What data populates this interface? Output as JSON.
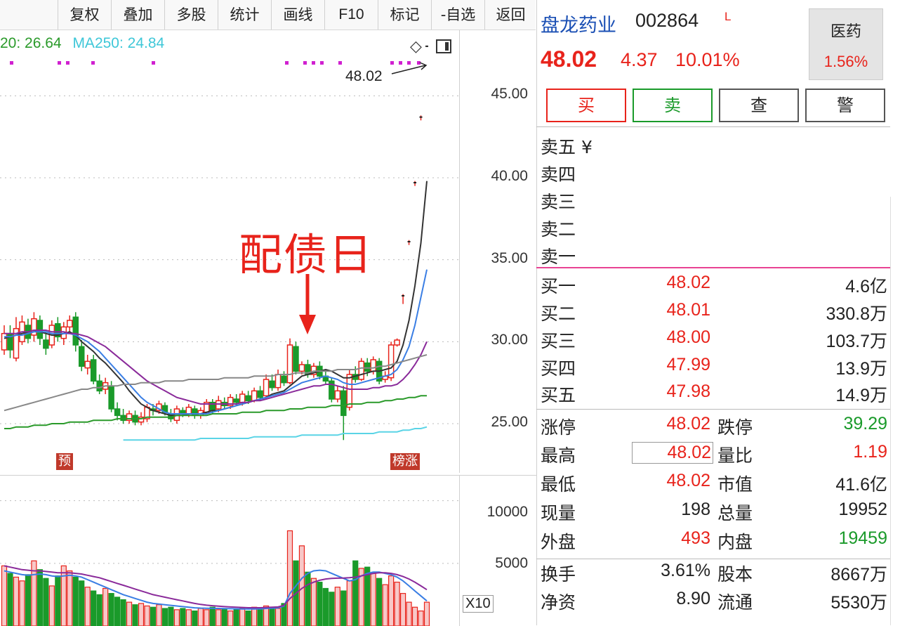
{
  "toolbar": {
    "items": [
      "复权",
      "叠加",
      "多股",
      "统计",
      "画线",
      "F10",
      "标记",
      "-自选",
      "返回"
    ]
  },
  "ma_legend": {
    "ma20": "20: 26.64",
    "ma250": "MA250: 24.84"
  },
  "chart": {
    "latest_price_label": "48.02",
    "annotation": "配债日",
    "badge_left": "预",
    "badge_right": "榜涨",
    "price_ticks": [
      "45.00",
      "40.00",
      "35.00",
      "30.00",
      "25.00"
    ],
    "volume_ticks": [
      "10000",
      "5000"
    ],
    "volume_scale": "X10",
    "colors": {
      "up": "#e8231b",
      "down": "#1a9a2a"
    }
  },
  "chart_data": {
    "type": "line",
    "title": "",
    "ylim": [
      22,
      49
    ],
    "candles": [
      {
        "o": 29.5,
        "c": 30.5,
        "h": 31.0,
        "l": 29.2
      },
      {
        "o": 30.5,
        "c": 29.5,
        "h": 31.0,
        "l": 29.0
      },
      {
        "o": 29.0,
        "c": 30.8,
        "h": 31.5,
        "l": 28.8
      },
      {
        "o": 30.0,
        "c": 31.2,
        "h": 31.6,
        "l": 29.8
      },
      {
        "o": 31.0,
        "c": 30.2,
        "h": 31.4,
        "l": 29.9
      },
      {
        "o": 30.4,
        "c": 31.4,
        "h": 31.8,
        "l": 30.0
      },
      {
        "o": 31.3,
        "c": 30.2,
        "h": 31.6,
        "l": 29.8
      },
      {
        "o": 30.1,
        "c": 29.6,
        "h": 30.6,
        "l": 29.2
      },
      {
        "o": 29.8,
        "c": 31.0,
        "h": 31.3,
        "l": 29.6
      },
      {
        "o": 31.1,
        "c": 30.3,
        "h": 31.5,
        "l": 30.0
      },
      {
        "o": 30.2,
        "c": 30.9,
        "h": 31.2,
        "l": 29.8
      },
      {
        "o": 30.9,
        "c": 31.3,
        "h": 31.6,
        "l": 30.6
      },
      {
        "o": 31.5,
        "c": 29.8,
        "h": 31.8,
        "l": 29.4
      },
      {
        "o": 29.7,
        "c": 28.5,
        "h": 30.1,
        "l": 28.2
      },
      {
        "o": 28.4,
        "c": 28.8,
        "h": 29.2,
        "l": 28.0
      },
      {
        "o": 28.9,
        "c": 27.6,
        "h": 29.2,
        "l": 27.4
      },
      {
        "o": 27.6,
        "c": 27.0,
        "h": 28.0,
        "l": 26.8
      },
      {
        "o": 27.1,
        "c": 27.5,
        "h": 27.8,
        "l": 26.8
      },
      {
        "o": 27.3,
        "c": 25.9,
        "h": 27.6,
        "l": 25.7
      },
      {
        "o": 25.9,
        "c": 25.5,
        "h": 26.3,
        "l": 25.2
      },
      {
        "o": 25.5,
        "c": 25.2,
        "h": 25.9,
        "l": 25.0
      },
      {
        "o": 25.2,
        "c": 25.6,
        "h": 25.8,
        "l": 25.0
      },
      {
        "o": 25.5,
        "c": 25.1,
        "h": 25.8,
        "l": 24.9
      },
      {
        "o": 25.1,
        "c": 25.4,
        "h": 25.7,
        "l": 24.9
      },
      {
        "o": 25.3,
        "c": 26.0,
        "h": 26.2,
        "l": 25.1
      },
      {
        "o": 25.9,
        "c": 25.8,
        "h": 26.2,
        "l": 25.5
      },
      {
        "o": 25.8,
        "c": 26.2,
        "h": 26.4,
        "l": 25.6
      },
      {
        "o": 26.1,
        "c": 25.7,
        "h": 26.3,
        "l": 25.5
      },
      {
        "o": 25.6,
        "c": 25.3,
        "h": 25.9,
        "l": 25.1
      },
      {
        "o": 25.2,
        "c": 25.9,
        "h": 26.1,
        "l": 25.0
      },
      {
        "o": 25.8,
        "c": 25.6,
        "h": 26.0,
        "l": 25.4
      },
      {
        "o": 25.6,
        "c": 26.0,
        "h": 26.2,
        "l": 25.4
      },
      {
        "o": 25.9,
        "c": 25.5,
        "h": 26.1,
        "l": 25.3
      },
      {
        "o": 25.5,
        "c": 25.8,
        "h": 26.0,
        "l": 25.3
      },
      {
        "o": 25.7,
        "c": 26.3,
        "h": 26.5,
        "l": 25.6
      },
      {
        "o": 26.3,
        "c": 25.8,
        "h": 26.5,
        "l": 25.6
      },
      {
        "o": 25.9,
        "c": 26.4,
        "h": 26.7,
        "l": 25.7
      },
      {
        "o": 26.3,
        "c": 26.1,
        "h": 26.6,
        "l": 25.9
      },
      {
        "o": 26.1,
        "c": 26.6,
        "h": 26.8,
        "l": 25.9
      },
      {
        "o": 26.5,
        "c": 26.3,
        "h": 26.8,
        "l": 26.1
      },
      {
        "o": 26.3,
        "c": 26.8,
        "h": 27.0,
        "l": 26.1
      },
      {
        "o": 26.7,
        "c": 26.4,
        "h": 27.0,
        "l": 26.2
      },
      {
        "o": 26.4,
        "c": 27.0,
        "h": 27.2,
        "l": 26.3
      },
      {
        "o": 27.0,
        "c": 26.6,
        "h": 27.3,
        "l": 26.4
      },
      {
        "o": 26.7,
        "c": 27.7,
        "h": 28.0,
        "l": 26.6
      },
      {
        "o": 27.6,
        "c": 27.2,
        "h": 28.0,
        "l": 27.0
      },
      {
        "o": 27.2,
        "c": 28.0,
        "h": 28.3,
        "l": 27.0
      },
      {
        "o": 27.9,
        "c": 27.5,
        "h": 28.2,
        "l": 27.3
      },
      {
        "o": 27.5,
        "c": 29.8,
        "h": 30.2,
        "l": 27.4
      },
      {
        "o": 29.7,
        "c": 28.2,
        "h": 30.0,
        "l": 28.0
      },
      {
        "o": 28.2,
        "c": 28.6,
        "h": 28.8,
        "l": 28.0
      },
      {
        "o": 28.6,
        "c": 28.0,
        "h": 28.9,
        "l": 27.8
      },
      {
        "o": 28.0,
        "c": 28.5,
        "h": 28.7,
        "l": 27.8
      },
      {
        "o": 28.5,
        "c": 27.9,
        "h": 28.8,
        "l": 27.7
      },
      {
        "o": 27.9,
        "c": 27.6,
        "h": 28.3,
        "l": 27.4
      },
      {
        "o": 27.6,
        "c": 26.5,
        "h": 27.8,
        "l": 26.3
      },
      {
        "o": 26.5,
        "c": 27.0,
        "h": 27.3,
        "l": 26.3
      },
      {
        "o": 27.0,
        "c": 25.5,
        "h": 27.3,
        "l": 24.0
      },
      {
        "o": 26.0,
        "c": 28.0,
        "h": 28.3,
        "l": 25.8
      },
      {
        "o": 28.0,
        "c": 27.7,
        "h": 28.5,
        "l": 27.5
      },
      {
        "o": 27.7,
        "c": 28.8,
        "h": 29.0,
        "l": 27.6
      },
      {
        "o": 28.7,
        "c": 28.2,
        "h": 29.0,
        "l": 27.9
      },
      {
        "o": 28.2,
        "c": 28.9,
        "h": 29.1,
        "l": 28.0
      },
      {
        "o": 28.8,
        "c": 27.6,
        "h": 29.0,
        "l": 27.4
      },
      {
        "o": 27.7,
        "c": 27.9,
        "h": 28.2,
        "l": 27.5
      },
      {
        "o": 27.8,
        "c": 29.8,
        "h": 30.0,
        "l": 27.6
      },
      {
        "o": 29.8,
        "c": 30.1,
        "h": 30.2,
        "l": 29.7
      },
      {
        "o": 32.4,
        "c": 32.8,
        "h": 32.9,
        "l": 32.3
      },
      {
        "o": 36.0,
        "c": 36.1,
        "h": 36.2,
        "l": 35.9
      },
      {
        "o": 39.6,
        "c": 39.7,
        "h": 39.8,
        "l": 39.5
      },
      {
        "o": 43.6,
        "c": 43.7,
        "h": 43.8,
        "l": 43.5
      },
      {
        "o": 48.0,
        "c": 48.02,
        "h": 48.02,
        "l": 48.0
      }
    ],
    "ma_lines": [
      {
        "color": "#333333",
        "values": [
          30.2,
          30.3,
          30.4,
          30.5,
          30.6,
          30.7,
          30.6,
          30.5,
          30.4,
          30.4,
          30.5,
          30.6,
          30.4,
          30.0,
          29.7,
          29.4,
          29.0,
          28.7,
          28.3,
          27.9,
          27.5,
          27.0,
          26.6,
          26.2,
          26.0,
          25.8,
          25.7,
          25.6,
          25.5,
          25.5,
          25.5,
          25.6,
          25.6,
          25.6,
          25.7,
          25.8,
          25.8,
          25.9,
          26.0,
          26.1,
          26.2,
          26.3,
          26.4,
          26.5,
          26.6,
          26.8,
          26.9,
          27.0,
          27.3,
          27.6,
          27.9,
          28.0,
          28.1,
          28.2,
          28.3,
          28.2,
          28.0,
          27.8,
          27.8,
          27.9,
          28.0,
          28.1,
          28.2,
          28.2,
          28.3,
          28.4,
          28.8,
          29.8,
          31.3,
          33.4,
          36.0,
          39.8
        ]
      },
      {
        "color": "#3a7ee4",
        "values": [
          30.3,
          30.3,
          30.4,
          30.4,
          30.5,
          30.6,
          30.6,
          30.6,
          30.5,
          30.5,
          30.5,
          30.5,
          30.4,
          30.2,
          30.0,
          29.7,
          29.4,
          29.0,
          28.6,
          28.2,
          27.8,
          27.4,
          27.0,
          26.6,
          26.3,
          26.1,
          25.9,
          25.7,
          25.6,
          25.6,
          25.6,
          25.6,
          25.6,
          25.6,
          25.6,
          25.7,
          25.8,
          25.9,
          26.0,
          26.1,
          26.2,
          26.3,
          26.4,
          26.5,
          26.6,
          26.7,
          26.8,
          26.9,
          27.1,
          27.3,
          27.5,
          27.6,
          27.7,
          27.8,
          27.9,
          27.8,
          27.7,
          27.5,
          27.4,
          27.4,
          27.5,
          27.6,
          27.7,
          27.8,
          27.9,
          28.0,
          28.3,
          28.9,
          29.7,
          31.0,
          32.7,
          34.4
        ]
      },
      {
        "color": "#8a2a9a",
        "values": [
          30.5,
          30.5,
          30.5,
          30.6,
          30.6,
          30.7,
          30.7,
          30.7,
          30.6,
          30.6,
          30.6,
          30.5,
          30.5,
          30.4,
          30.3,
          30.1,
          29.9,
          29.7,
          29.4,
          29.1,
          28.8,
          28.5,
          28.2,
          27.9,
          27.6,
          27.4,
          27.2,
          27.0,
          26.8,
          26.6,
          26.5,
          26.4,
          26.3,
          26.2,
          26.2,
          26.2,
          26.2,
          26.2,
          26.2,
          26.2,
          26.3,
          26.3,
          26.4,
          26.4,
          26.5,
          26.6,
          26.7,
          26.8,
          26.9,
          27.0,
          27.1,
          27.2,
          27.3,
          27.3,
          27.4,
          27.4,
          27.3,
          27.2,
          27.1,
          27.1,
          27.1,
          27.1,
          27.2,
          27.2,
          27.3,
          27.3,
          27.4,
          27.7,
          28.1,
          28.6,
          29.2,
          30.0
        ]
      },
      {
        "color": "#888888",
        "values": [
          25.8,
          25.9,
          26.0,
          26.1,
          26.2,
          26.3,
          26.4,
          26.5,
          26.6,
          26.7,
          26.8,
          26.9,
          27.0,
          27.1,
          27.1,
          27.2,
          27.2,
          27.3,
          27.3,
          27.3,
          27.4,
          27.4,
          27.4,
          27.5,
          27.5,
          27.5,
          27.5,
          27.6,
          27.6,
          27.6,
          27.6,
          27.7,
          27.7,
          27.7,
          27.7,
          27.7,
          27.7,
          27.8,
          27.8,
          27.8,
          27.8,
          27.8,
          27.9,
          27.9,
          27.9,
          27.9,
          28.0,
          28.0,
          28.0,
          28.1,
          28.1,
          28.1,
          28.2,
          28.2,
          28.2,
          28.2,
          28.3,
          28.3,
          28.3,
          28.3,
          28.4,
          28.4,
          28.4,
          28.5,
          28.5,
          28.6,
          28.7,
          28.8,
          28.9,
          29.0,
          29.1,
          29.2
        ]
      },
      {
        "color": "#2a9a2a",
        "values": [
          24.7,
          24.7,
          24.8,
          24.8,
          24.8,
          24.9,
          24.9,
          24.9,
          25.0,
          25.0,
          25.0,
          25.1,
          25.1,
          25.1,
          25.1,
          25.2,
          25.2,
          25.2,
          25.2,
          25.3,
          25.3,
          25.3,
          25.3,
          25.3,
          25.4,
          25.4,
          25.4,
          25.4,
          25.4,
          25.5,
          25.5,
          25.5,
          25.5,
          25.5,
          25.5,
          25.6,
          25.6,
          25.6,
          25.6,
          25.6,
          25.7,
          25.7,
          25.7,
          25.7,
          25.8,
          25.8,
          25.8,
          25.8,
          25.9,
          25.9,
          25.9,
          26.0,
          26.0,
          26.0,
          26.0,
          26.1,
          26.1,
          26.1,
          26.2,
          26.2,
          26.2,
          26.3,
          26.3,
          26.3,
          26.4,
          26.4,
          26.5,
          26.5,
          26.6,
          26.6,
          26.7,
          26.7
        ]
      },
      {
        "color": "#5ad4e6",
        "values": [
          null,
          null,
          null,
          null,
          null,
          null,
          null,
          null,
          null,
          null,
          null,
          null,
          null,
          null,
          null,
          null,
          null,
          null,
          null,
          null,
          24.0,
          24.0,
          24.0,
          24.0,
          24.0,
          24.0,
          24.0,
          24.0,
          24.0,
          24.0,
          24.0,
          24.0,
          24.0,
          24.1,
          24.1,
          24.1,
          24.1,
          24.1,
          24.1,
          24.1,
          24.1,
          24.1,
          24.2,
          24.2,
          24.2,
          24.2,
          24.2,
          24.2,
          24.2,
          24.2,
          24.3,
          24.3,
          24.3,
          24.3,
          24.3,
          24.3,
          24.3,
          24.4,
          24.4,
          24.4,
          24.4,
          24.4,
          24.4,
          24.5,
          24.5,
          24.5,
          24.5,
          24.6,
          24.6,
          24.7,
          24.7,
          24.8
        ]
      }
    ],
    "volumes": [
      480,
      420,
      390,
      360,
      410,
      520,
      450,
      380,
      320,
      400,
      480,
      440,
      390,
      360,
      310,
      280,
      250,
      300,
      260,
      230,
      210,
      190,
      170,
      180,
      160,
      150,
      170,
      140,
      150,
      130,
      140,
      130,
      120,
      140,
      130,
      150,
      130,
      140,
      120,
      130,
      140,
      120,
      150,
      130,
      160,
      150,
      140,
      180,
      760,
      520,
      640,
      430,
      380,
      350,
      300,
      270,
      310,
      280,
      360,
      520,
      460,
      470,
      420,
      380,
      330,
      400,
      350,
      260,
      190,
      150,
      120,
      190
    ],
    "vol_ma": [
      {
        "color": "#3a7ee4",
        "values": [
          440,
          430,
          420,
          410,
          405,
          410,
          415,
          410,
          400,
          395,
          400,
          405,
          400,
          390,
          370,
          350,
          330,
          310,
          290,
          270,
          250,
          235,
          220,
          205,
          190,
          180,
          175,
          170,
          165,
          160,
          155,
          150,
          145,
          143,
          142,
          141,
          140,
          139,
          138,
          137,
          136,
          135,
          136,
          137,
          140,
          142,
          144,
          160,
          260,
          320,
          380,
          420,
          440,
          445,
          440,
          420,
          400,
          380,
          360,
          370,
          400,
          420,
          430,
          430,
          420,
          410,
          390,
          360,
          320,
          280,
          240,
          200
        ]
      },
      {
        "color": "#8a2a9a",
        "values": [
          480,
          470,
          460,
          450,
          445,
          440,
          440,
          435,
          430,
          425,
          425,
          425,
          420,
          415,
          405,
          395,
          385,
          370,
          355,
          340,
          325,
          310,
          295,
          280,
          265,
          250,
          240,
          230,
          220,
          210,
          200,
          190,
          180,
          172,
          166,
          162,
          158,
          155,
          152,
          150,
          148,
          146,
          146,
          146,
          148,
          150,
          152,
          165,
          220,
          260,
          300,
          330,
          350,
          365,
          375,
          380,
          382,
          383,
          385,
          390,
          400,
          410,
          420,
          425,
          425,
          420,
          410,
          395,
          375,
          350,
          320,
          290
        ]
      }
    ]
  },
  "panel": {
    "stock_name": "盘龙药业",
    "stock_code": "002864",
    "stock_flag": "L",
    "price": "48.02",
    "change": "4.37",
    "change_pct": "10.01%",
    "sector": {
      "name": "医药",
      "pct": "1.56%"
    },
    "actions": {
      "buy": "买",
      "sell": "卖",
      "query": "查",
      "alert": "警"
    },
    "sell_levels": [
      {
        "label": "卖五 ¥"
      },
      {
        "label": "卖四"
      },
      {
        "label": "卖三"
      },
      {
        "label": "卖二"
      },
      {
        "label": "卖一"
      }
    ],
    "buy_levels": [
      {
        "label": "买一",
        "price": "48.02",
        "vol": "4.6亿"
      },
      {
        "label": "买二",
        "price": "48.01",
        "vol": "330.8万"
      },
      {
        "label": "买三",
        "price": "48.00",
        "vol": "103.7万"
      },
      {
        "label": "买四",
        "price": "47.99",
        "vol": "13.9万"
      },
      {
        "label": "买五",
        "price": "47.98",
        "vol": "14.9万"
      }
    ],
    "stats": [
      {
        "l1": "涨停",
        "v1": "48.02",
        "c1": "red",
        "l2": "跌停",
        "v2": "39.29",
        "c2": "green"
      },
      {
        "l1": "最高",
        "v1": "48.02",
        "c1": "red",
        "l2": "量比",
        "v2": "1.19",
        "c2": "red"
      },
      {
        "l1": "最低",
        "v1": "48.02",
        "c1": "red",
        "l2": "市值",
        "v2": "41.6亿",
        "c2": "dark"
      },
      {
        "l1": "现量",
        "v1": "198",
        "c1": "dark",
        "l2": "总量",
        "v2": "19952",
        "c2": "dark"
      },
      {
        "l1": "外盘",
        "v1": "493",
        "c1": "red",
        "l2": "内盘",
        "v2": "19459",
        "c2": "green"
      }
    ],
    "stats2": [
      {
        "l1": "换手",
        "v1": "3.61%",
        "l2": "股本",
        "v2": "8667万"
      },
      {
        "l1": "净资",
        "v1": "8.90",
        "l2": "流通",
        "v2": "5530万"
      }
    ]
  }
}
